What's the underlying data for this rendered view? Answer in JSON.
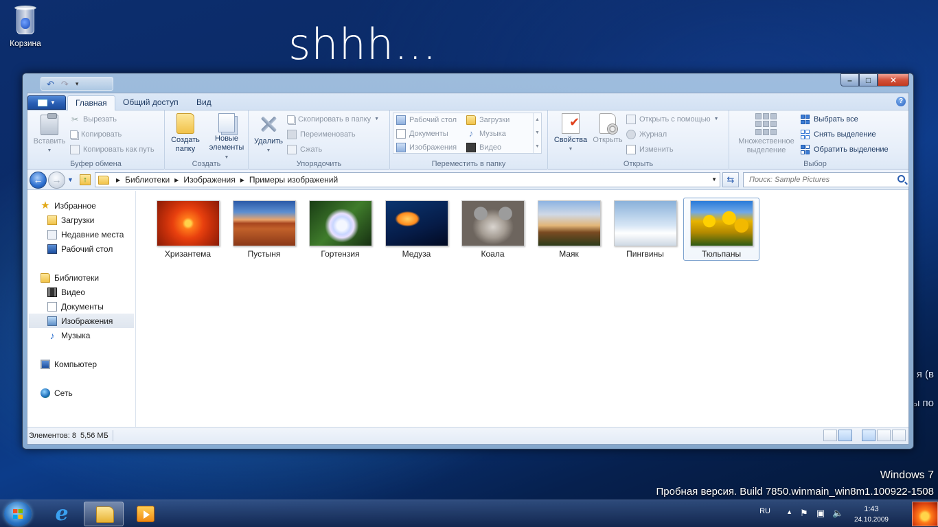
{
  "desktop": {
    "recycle_bin_label": "Корзина",
    "overlay_text": "shhh...",
    "side_text_1": "я (в",
    "side_text_2": "ы по",
    "watermark_line1": "Windows 7",
    "watermark_line2": "Пробная версия. Build 7850.winmain_win8m1.100922-1508"
  },
  "window": {
    "quick_access": {
      "undo": "undo-icon",
      "redo": "redo-icon"
    },
    "controls": {
      "minimize": "–",
      "maximize": "□",
      "close": "✕"
    }
  },
  "ribbon": {
    "tabs": [
      {
        "label": "Главная",
        "active": true
      },
      {
        "label": "Общий доступ",
        "active": false
      },
      {
        "label": "Вид",
        "active": false
      }
    ],
    "help": "?",
    "groups": {
      "clipboard": {
        "label": "Буфер обмена",
        "paste": "Вставить",
        "cut": "Вырезать",
        "copy": "Копировать",
        "copy_path": "Копировать как путь"
      },
      "create": {
        "label": "Создать",
        "new_folder_line1": "Создать",
        "new_folder_line2": "папку",
        "new_items_line1": "Новые",
        "new_items_line2": "элементы"
      },
      "organize": {
        "label": "Упорядочить",
        "delete": "Удалить",
        "copy_to": "Скопировать в папку",
        "rename": "Переименовать",
        "compress": "Сжать"
      },
      "move": {
        "label": "Переместить в папку",
        "desktop": "Рабочий стол",
        "documents": "Документы",
        "pictures": "Изображения",
        "downloads": "Загрузки",
        "music": "Музыка",
        "video": "Видео"
      },
      "open": {
        "label": "Открыть",
        "properties": "Свойства",
        "open": "Открыть",
        "open_with": "Открыть с помощью",
        "history": "Журнал",
        "edit": "Изменить"
      },
      "select": {
        "label": "Выбор",
        "multi_line1": "Множественное",
        "multi_line2": "выделение",
        "select_all": "Выбрать все",
        "select_none": "Снять выделение",
        "invert": "Обратить выделение"
      }
    }
  },
  "address": {
    "crumbs": [
      "Библиотеки",
      "Изображения",
      "Примеры изображений"
    ],
    "search_placeholder": "Поиск: Sample Pictures"
  },
  "nav": {
    "favorites": "Избранное",
    "downloads": "Загрузки",
    "recent": "Недавние места",
    "desktop": "Рабочий стол",
    "libraries": "Библиотеки",
    "video": "Видео",
    "documents": "Документы",
    "pictures": "Изображения",
    "music": "Музыка",
    "computer": "Компьютер",
    "network": "Сеть"
  },
  "files": [
    {
      "name": "Хризантема",
      "selected": false
    },
    {
      "name": "Пустыня",
      "selected": false
    },
    {
      "name": "Гортензия",
      "selected": false
    },
    {
      "name": "Медуза",
      "selected": false
    },
    {
      "name": "Коала",
      "selected": false
    },
    {
      "name": "Маяк",
      "selected": false
    },
    {
      "name": "Пингвины",
      "selected": false
    },
    {
      "name": "Тюльпаны",
      "selected": true
    }
  ],
  "status": {
    "items_text": "Элементов: 8",
    "size_text": "5,56 МБ"
  },
  "taskbar": {
    "language": "RU",
    "time": "1:43",
    "date": "24.10.2009"
  }
}
